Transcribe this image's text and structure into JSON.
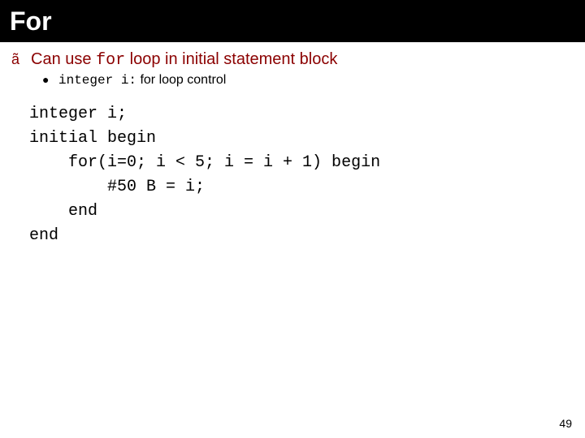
{
  "title": "For",
  "bullet": {
    "marker": "ã",
    "before_code": "Can use ",
    "code": "for",
    "after_code": " loop in initial statement block"
  },
  "subbullet": {
    "marker": "●",
    "code": "integer i:",
    "after_code": " for loop control"
  },
  "code_block": "integer i;\ninitial begin\n    for(i=0; i < 5; i = i + 1) begin\n        #50 B = i;\n    end\nend",
  "page_number": "49"
}
